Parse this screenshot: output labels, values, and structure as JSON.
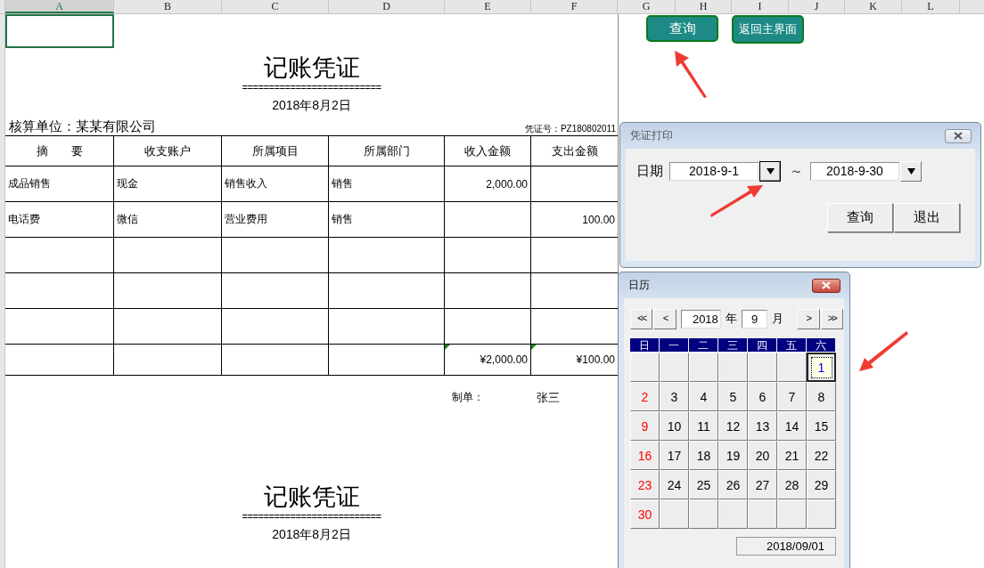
{
  "column_headers": [
    {
      "label": "A",
      "selected": true
    },
    {
      "label": "B",
      "selected": false
    },
    {
      "label": "C",
      "selected": false
    },
    {
      "label": "D",
      "selected": false
    },
    {
      "label": "E",
      "selected": false
    },
    {
      "label": "F",
      "selected": false
    },
    {
      "label": "G",
      "selected": false
    },
    {
      "label": "H",
      "selected": false
    },
    {
      "label": "I",
      "selected": false
    },
    {
      "label": "J",
      "selected": false
    },
    {
      "label": "K",
      "selected": false
    },
    {
      "label": "L",
      "selected": false
    }
  ],
  "vouchers": [
    {
      "title": "记账凭证",
      "underline": "==========================",
      "date": "2018年8月2日",
      "unit": "核算单位：某某有限公司",
      "voucher_no": "凭证号：PZ180802011",
      "columns": [
        "摘　　要",
        "收支账户",
        "所属项目",
        "所属部门",
        "收入金额",
        "支出金额"
      ],
      "rows": [
        [
          "成品销售",
          "现金",
          "销售收入",
          "销售",
          "2,000.00",
          ""
        ],
        [
          "电话费",
          "微信",
          "营业费用",
          "销售",
          "",
          "100.00"
        ]
      ],
      "totals": {
        "income": "¥2,000.00",
        "expense": "¥100.00"
      },
      "maker_label": "制单：",
      "maker": "张三"
    },
    {
      "title": "记账凭证",
      "underline": "==========================",
      "date": "2018年8月2日"
    }
  ],
  "sheet_buttons": [
    {
      "label": "查询"
    },
    {
      "label": "返回主界面"
    }
  ],
  "print_dialog": {
    "title": "凭证打印",
    "date_label": "日期",
    "from": {
      "value": "2018-9-1",
      "focused": true
    },
    "separator": "～",
    "to": {
      "value": "2018-9-30",
      "focused": false
    },
    "buttons": [
      "查询",
      "退出"
    ]
  },
  "calendar": {
    "title": "日历",
    "nav_prev": [
      "<<",
      "<"
    ],
    "nav_next": [
      ">",
      ">>"
    ],
    "year": "2018",
    "year_label": "年",
    "month": "9",
    "month_label": "月",
    "weekdays": [
      "日",
      "一",
      "二",
      "三",
      "四",
      "五",
      "六"
    ],
    "weeks": [
      [
        {
          "day": "1",
          "selected": true
        }
      ],
      [
        {
          "day": "2",
          "selected": false
        },
        {
          "day": "3",
          "selected": false
        },
        {
          "day": "4",
          "selected": false
        },
        {
          "day": "5",
          "selected": false
        },
        {
          "day": "6",
          "selected": false
        },
        {
          "day": "7",
          "selected": false
        },
        {
          "day": "8",
          "selected": false
        }
      ],
      [
        {
          "day": "9",
          "selected": false
        },
        {
          "day": "10",
          "selected": false
        },
        {
          "day": "11",
          "selected": false
        },
        {
          "day": "12",
          "selected": false
        },
        {
          "day": "13",
          "selected": false
        },
        {
          "day": "14",
          "selected": false
        },
        {
          "day": "15",
          "selected": false
        }
      ],
      [
        {
          "day": "16",
          "selected": false
        },
        {
          "day": "17",
          "selected": false
        },
        {
          "day": "18",
          "selected": false
        },
        {
          "day": "19",
          "selected": false
        },
        {
          "day": "20",
          "selected": false
        },
        {
          "day": "21",
          "selected": false
        },
        {
          "day": "22",
          "selected": false
        }
      ],
      [
        {
          "day": "23",
          "selected": false
        },
        {
          "day": "24",
          "selected": false
        },
        {
          "day": "25",
          "selected": false
        },
        {
          "day": "26",
          "selected": false
        },
        {
          "day": "27",
          "selected": false
        },
        {
          "day": "28",
          "selected": false
        },
        {
          "day": "29",
          "selected": false
        }
      ],
      [
        {
          "day": "30",
          "selected": false
        }
      ]
    ],
    "current_date": "2018/09/01"
  }
}
